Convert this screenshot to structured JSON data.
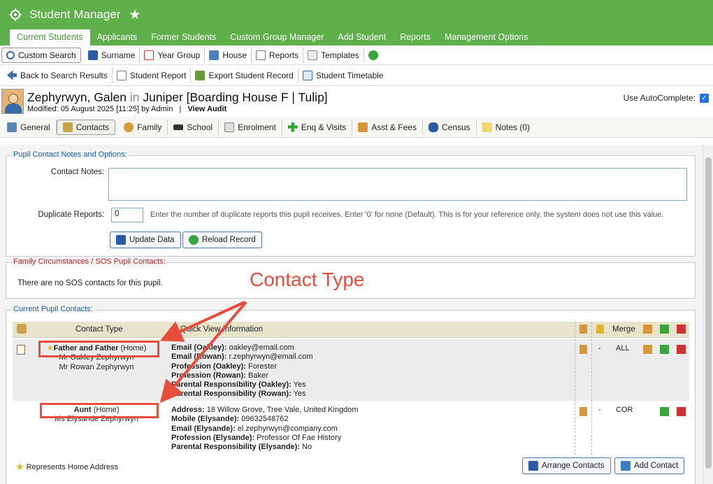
{
  "app": {
    "title": "Student Manager"
  },
  "nav_tabs": [
    "Current Students",
    "Applicants",
    "Former Students",
    "Custom Group Manager",
    "Add Student",
    "Reports",
    "Management Options"
  ],
  "toolbar1": [
    "Custom Search",
    "Surname",
    "Year Group",
    "House",
    "Reports",
    "Templates"
  ],
  "toolbar2": [
    "Back to Search Results",
    "Student Report",
    "Export Student Record",
    "Student Timetable"
  ],
  "pupil": {
    "surname": "Zephyrwyn, Galen",
    "in": "in",
    "house": "Juniper  [Boarding House F | Tulip]",
    "modified": "Modified: 05 August 2025 [11:25] by Admin",
    "sep": "|",
    "view_audit": "View Audit",
    "autocomplete_label": "Use AutoComplete:"
  },
  "subtabs": [
    "General",
    "Contacts",
    "Family",
    "School",
    "Enrolment",
    "Enq & Visits",
    "Asst & Fees",
    "Census",
    "Notes (0)"
  ],
  "notes_section": {
    "legend": "Pupil Contact Notes and Options:",
    "contact_notes_label": "Contact Notes:",
    "duplicate_label": "Duplicate Reports:",
    "duplicate_value": "0",
    "duplicate_hint": "Enter the number of duplicate reports this pupil receives. Enter '0' for none (Default). This is for your reference only, the system does not use this value.",
    "update_btn": "Update Data",
    "reload_btn": "Reload Record"
  },
  "sos_section": {
    "legend": "Family Circumstances / SOS Pupil Contacts:",
    "text": "There are no SOS contacts for this pupil."
  },
  "contacts_section": {
    "legend": "Current Pupil Contacts:",
    "headers": {
      "contact_type": "Contact Type",
      "quick_view": "Quick View Information",
      "merge": "Merge"
    },
    "rows": [
      {
        "type": "Father and Father",
        "home": "(Home)",
        "names": [
          "Mr Oakley Zephyrwyn",
          "Mr Rowan Zephyrwyn"
        ],
        "info": [
          [
            "Email (Oakley):",
            " oakley@email.com"
          ],
          [
            "Email (Rowan):",
            " r.zephyrwyn@email.com"
          ],
          [
            "Profession (Oakley):",
            " Forester"
          ],
          [
            "Profession (Rowan):",
            " Baker"
          ],
          [
            "Parental Responsibility (Oakley):",
            " Yes"
          ],
          [
            "Parental Responsibility (Rowan):",
            " Yes"
          ]
        ],
        "lock": "-",
        "merge": "ALL"
      },
      {
        "type": "Aunt",
        "home": "(Home)",
        "names": [
          "Ms Elysande Zephyrwyn"
        ],
        "info": [
          [
            "Address:",
            " 18 Willow Grove, Tree Vale, United Kingdom"
          ],
          [
            "Mobile (Elysande):",
            " 09632548762"
          ],
          [
            "Email (Elysande):",
            " el.zephyrwyn@company.com"
          ],
          [
            "Profession (Elysande):",
            " Professor Of Fae History"
          ],
          [
            "Parental Responsibility (Elysande):",
            " No"
          ]
        ],
        "lock": "-",
        "merge": "COR"
      }
    ],
    "legend_note": "Represents Home Address",
    "arrange_btn": "Arrange Contacts",
    "add_btn": "Add Contact"
  },
  "annotation": {
    "label": "Contact Type"
  },
  "colors": {
    "brand_green": "#5eb04a",
    "annotation_red": "#e74c3c",
    "link_blue": "#1a5fb4"
  }
}
